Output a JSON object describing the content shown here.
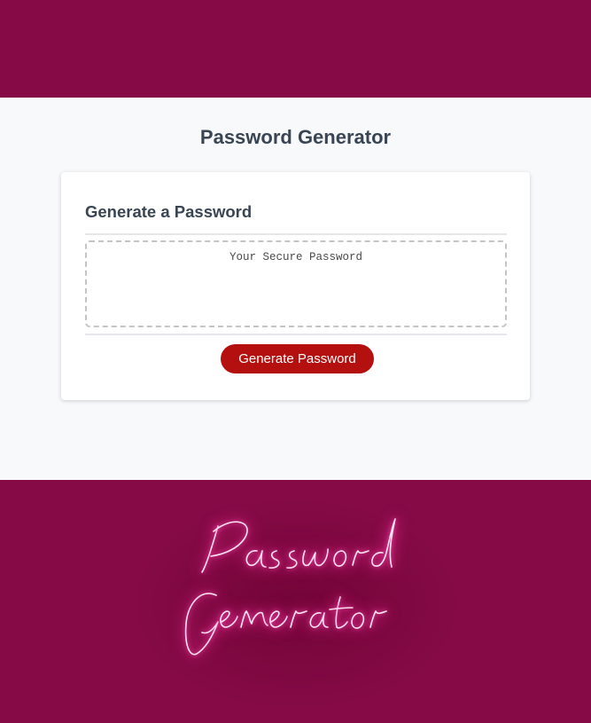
{
  "header": {
    "title": "Password Generator"
  },
  "card": {
    "title": "Generate a Password",
    "password_placeholder": "Your Secure Password",
    "password_value": "",
    "button_label": "Generate Password"
  },
  "neon_sign": {
    "text_line_1": "Password",
    "text_line_2": "Generator"
  },
  "colors": {
    "brand_band": "#850a46",
    "button": "#b3100f",
    "heading": "#3a4553",
    "neon_glow": "#ff2f9e"
  }
}
